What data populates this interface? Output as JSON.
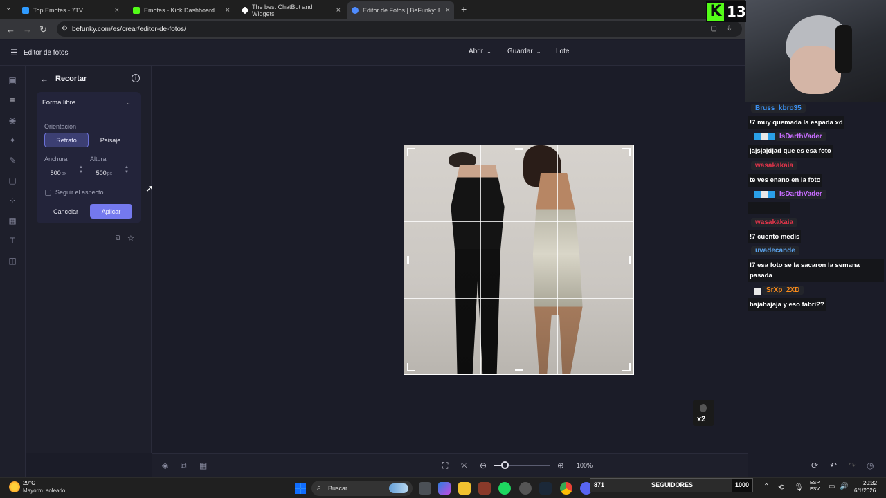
{
  "browser": {
    "tabs": [
      {
        "label": "Top Emotes - 7TV",
        "color": "#2f9bff"
      },
      {
        "label": "Emotes - Kick Dashboard",
        "color": "#53fc18"
      },
      {
        "label": "The best ChatBot and Widgets",
        "color": "#ffffff"
      },
      {
        "label": "Editor de Fotos | BeFunky: Edita",
        "color": "#4f8cff",
        "active": true
      }
    ],
    "url": "befunky.com/es/crear/editor-de-fotos/"
  },
  "app": {
    "title": "Editor de fotos",
    "menu": {
      "open": "Abrir",
      "save": "Guardar",
      "batch": "Lote"
    }
  },
  "panel": {
    "title": "Recortar",
    "shape_select": "Forma libre",
    "orientation_label": "Orientación",
    "portrait": "Retrato",
    "landscape": "Paisaje",
    "width_label": "Anchura",
    "height_label": "Altura",
    "width_value": "500",
    "height_value": "500",
    "unit": "px",
    "aspect_label": "Seguir el aspecto",
    "cancel": "Cancelar",
    "apply": "Aplicar"
  },
  "canvas": {
    "zoom": "100%"
  },
  "stream": {
    "kick_count": "13",
    "chat": [
      {
        "user": "Bruss_kbro35",
        "color": "#3b8ff0",
        "msg": "!7 muy quemada la espada xd"
      },
      {
        "user": "IsDarthVader",
        "color": "#c86cff",
        "msg": "jajsjajdjad que es esa foto"
      },
      {
        "user": "wasakakaia",
        "color": "#e0344a",
        "msg": "te ves enano en la foto"
      },
      {
        "user": "IsDarthVader",
        "color": "#c86cff",
        "msg": "᠎ ᠎ ᠎ ᠎"
      },
      {
        "user": "wasakakaia",
        "color": "#e0344a",
        "msg": "!7 cuento medis"
      },
      {
        "user": "uvadecande",
        "color": "#5aa0e8",
        "msg": "!7 esa foto se la sacaron la semana pasada"
      },
      {
        "user": "SrXp_2XD",
        "color": "#ff8c1a",
        "msg": "hajahajaja y eso fabri??"
      }
    ],
    "x2_badge": "x2"
  },
  "taskbar": {
    "weather_temp": "29°C",
    "weather_desc": "Mayorm. soleado",
    "search": "Buscar",
    "followers_current": "871",
    "followers_label": "SEGUIDORES",
    "followers_goal": "1000",
    "followers_progress": 0.871,
    "lang": "ESP",
    "lang2": "ESV",
    "time": "20:32",
    "date": "6/1/2026"
  }
}
